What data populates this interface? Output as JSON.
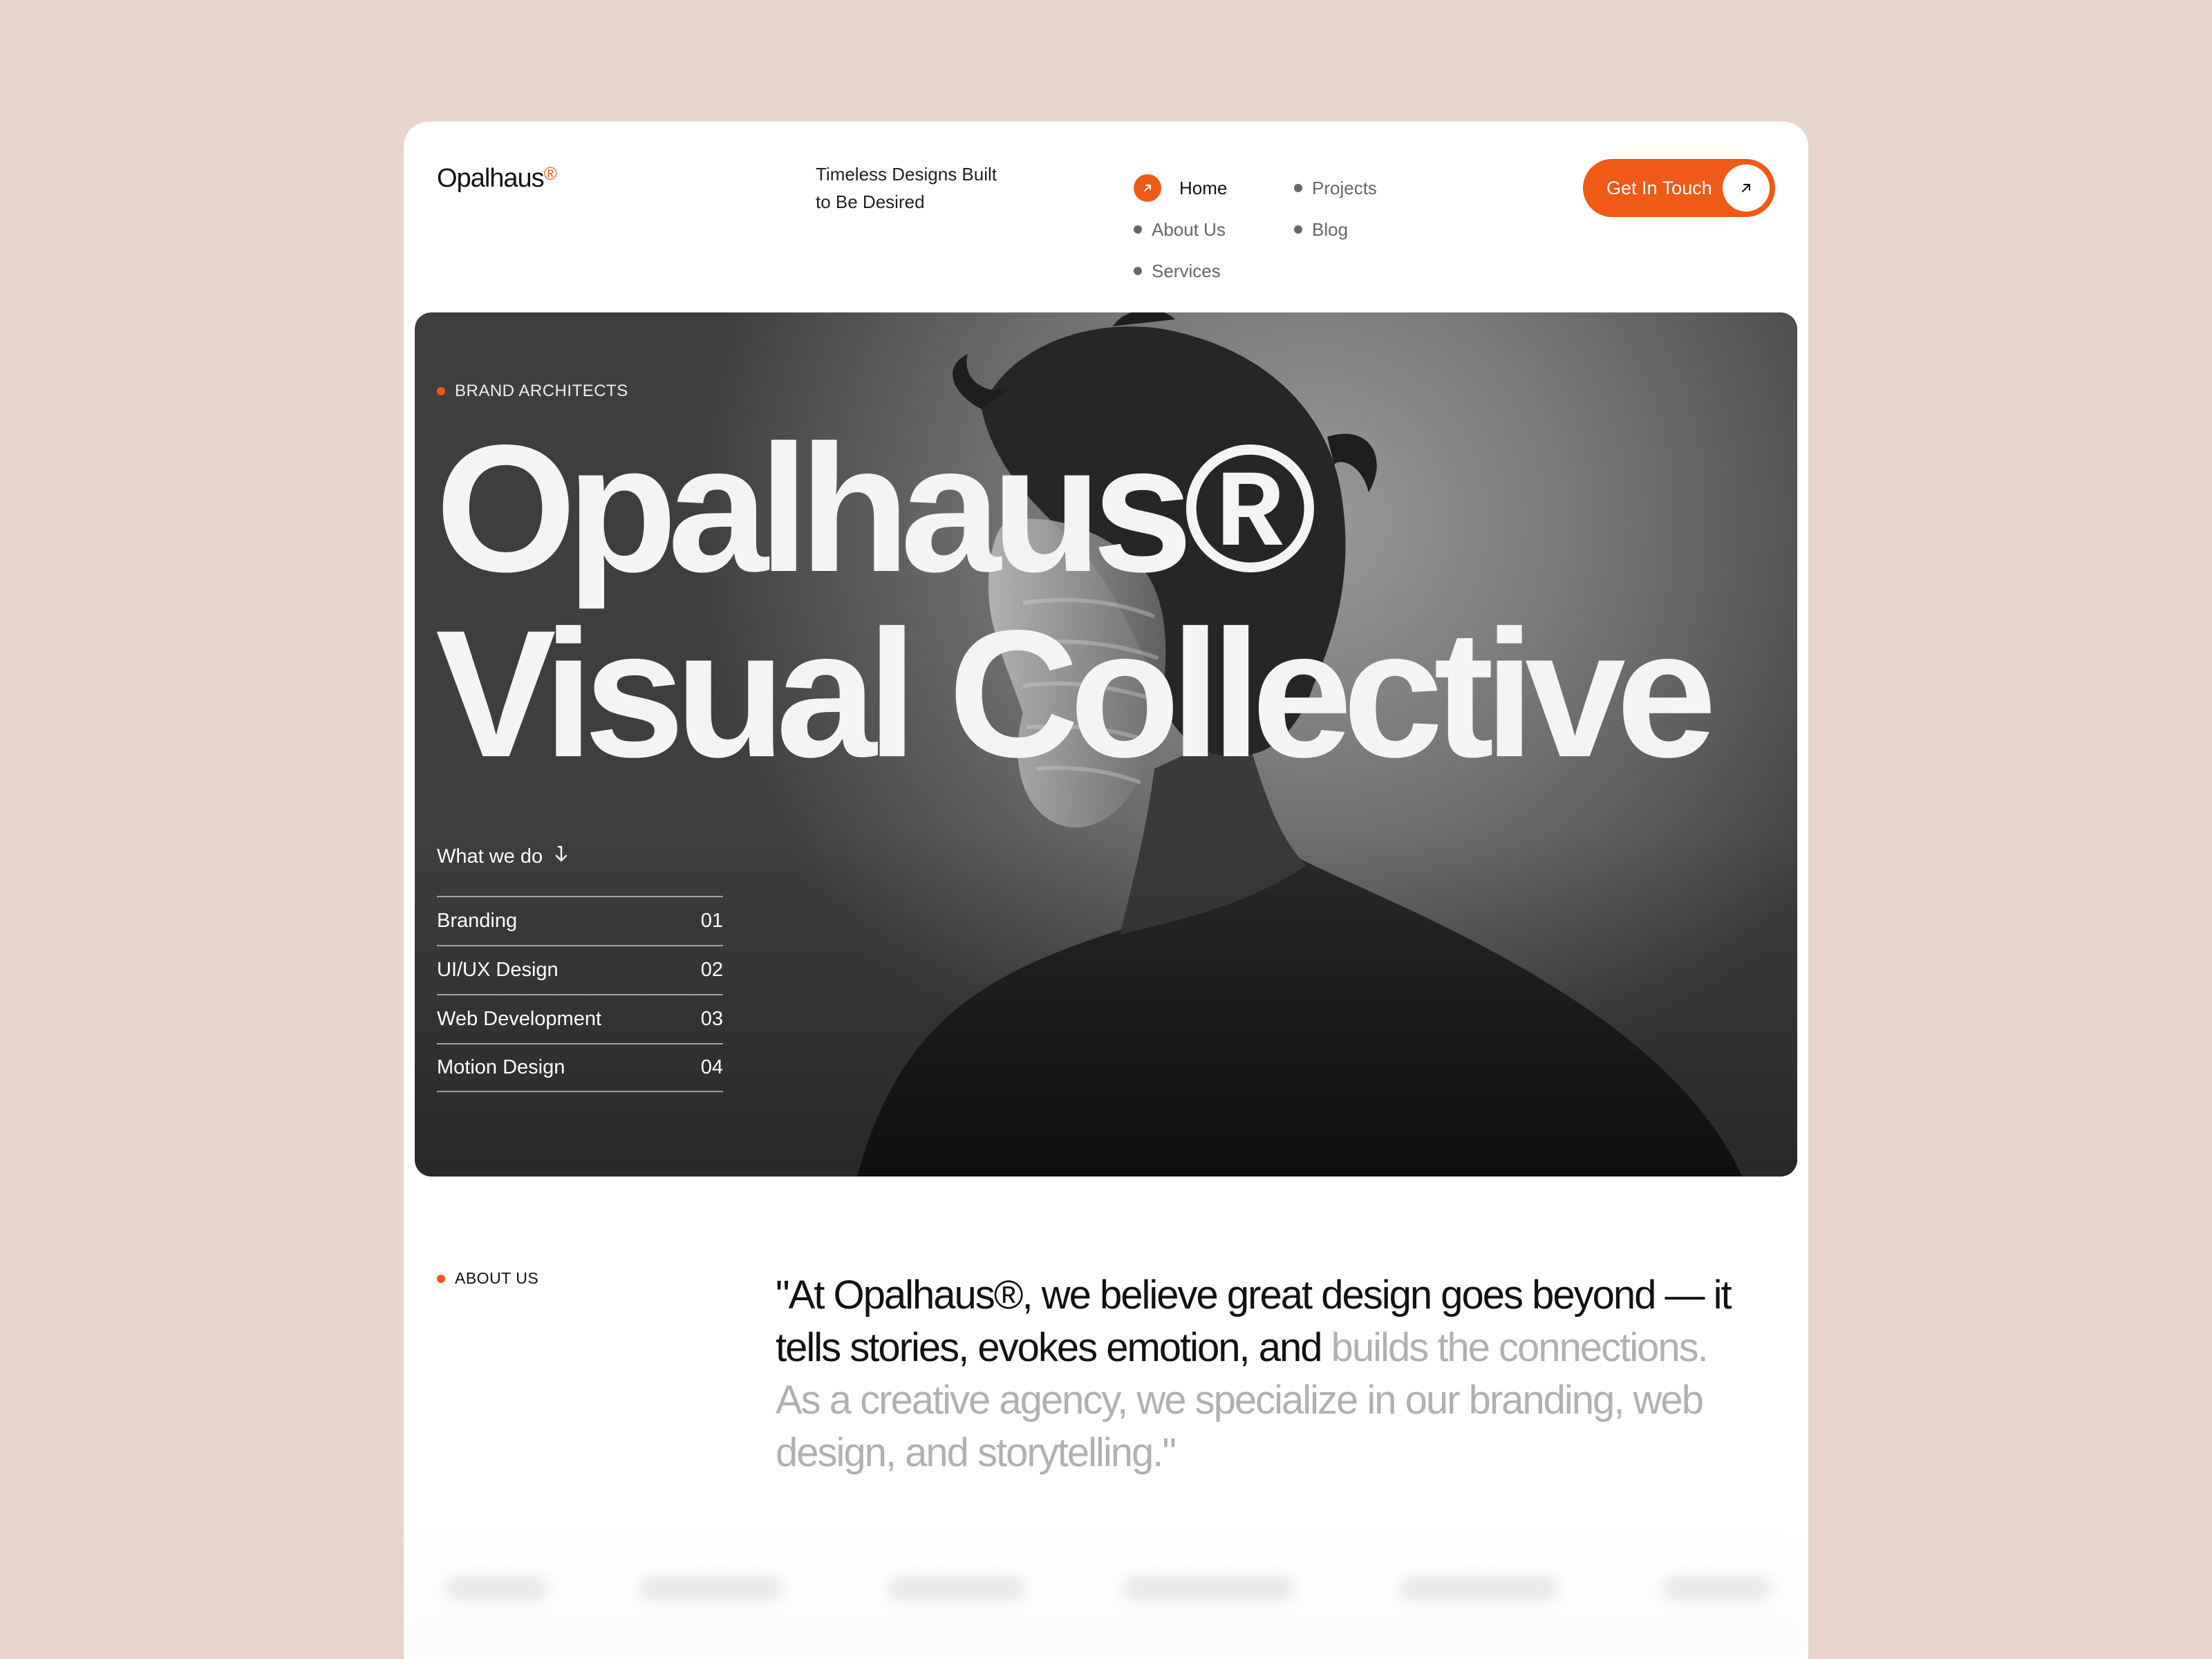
{
  "header": {
    "logo": "Opalhaus",
    "logo_mark": "®",
    "tagline_line1": "Timeless Designs Built",
    "tagline_line2": "to Be Desired",
    "nav": [
      {
        "label": "Home",
        "active": true
      },
      {
        "label": "Projects"
      },
      {
        "label": "About Us"
      },
      {
        "label": "Blog"
      },
      {
        "label": "Services"
      }
    ],
    "cta_label": "Get In Touch",
    "cta_icon": "arrow-up-right-icon"
  },
  "hero": {
    "label": "BRAND ARCHITECTS",
    "title_line1": "Opalhaus®",
    "title_line2": "Visual Collective",
    "what_we_do": "What we do",
    "services": [
      {
        "name": "Branding",
        "num": "01"
      },
      {
        "name": "UI/UX Design",
        "num": "02"
      },
      {
        "name": "Web Development",
        "num": "03"
      },
      {
        "name": "Motion Design",
        "num": "04"
      }
    ]
  },
  "about": {
    "label": "ABOUT US",
    "quote_strong": "\"At Opalhaus®, we believe great design goes beyond — it tells stories, evokes emotion, and ",
    "quote_muted": "builds the connections. As a creative agency, we specialize in our branding, web design, and storytelling.\""
  },
  "colors": {
    "accent": "#f05a16",
    "background": "#e8d6cc",
    "card": "#ffffff"
  }
}
